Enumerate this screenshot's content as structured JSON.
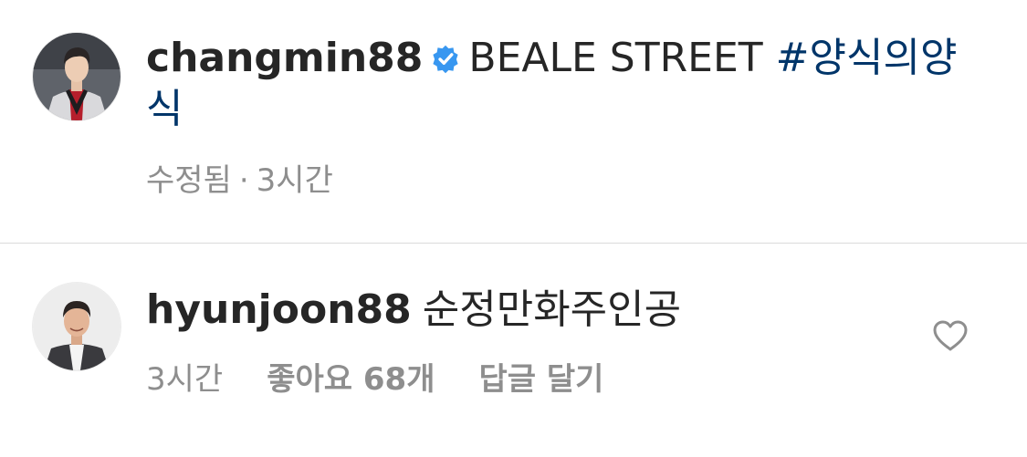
{
  "post": {
    "author": "changmin88",
    "caption_text": "BEALE STREET",
    "hashtag": "#양식의양식",
    "edited_label": "수정됨",
    "separator": "·",
    "time": "3시간",
    "verified_icon": "verified-badge-icon",
    "verified_color": "#3897f0"
  },
  "comment": {
    "author": "hyunjoon88",
    "text": "순정만화주인공",
    "time": "3시간",
    "likes_label": "좋아요 68개",
    "reply_label": "답글 달기",
    "like_icon": "heart-outline-icon"
  },
  "colors": {
    "text": "#262626",
    "secondary": "#8e8e8e",
    "hashtag": "#003569",
    "divider": "#dbdbdb"
  }
}
